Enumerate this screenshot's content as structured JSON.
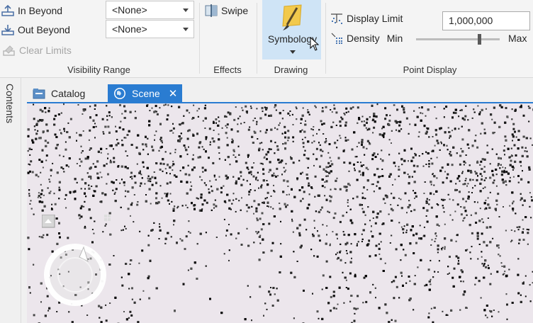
{
  "ribbon": {
    "visibility_range": {
      "label": "Visibility Range",
      "in_beyond": "In Beyond",
      "out_beyond": "Out Beyond",
      "clear_limits": "Clear Limits",
      "in_value": "<None>",
      "out_value": "<None>"
    },
    "effects": {
      "label": "Effects",
      "swipe": "Swipe"
    },
    "drawing": {
      "label": "Drawing",
      "symbology": "Symbology"
    },
    "point_display": {
      "label": "Point Display",
      "display_limit": "Display Limit",
      "display_limit_value": "1,000,000",
      "density": "Density",
      "min": "Min",
      "max": "Max",
      "density_level": 0.75
    }
  },
  "contents": {
    "label": "Contents"
  },
  "tabs": [
    {
      "label": "Catalog",
      "active": false
    },
    {
      "label": "Scene",
      "active": true
    }
  ],
  "icons": {
    "in_beyond": "in-beyond-icon",
    "out_beyond": "out-beyond-icon",
    "clear_limits": "clear-limits-icon",
    "swipe": "swipe-icon",
    "symbology": "paintbrush-icon",
    "display_limit": "display-limit-icon",
    "density": "density-icon",
    "catalog": "catalog-icon",
    "scene": "globe-icon",
    "close": "close-icon",
    "navigator": "navigator-icon"
  },
  "colors": {
    "accent": "#2a7cd1",
    "scene_bg": "#ece6ec"
  }
}
